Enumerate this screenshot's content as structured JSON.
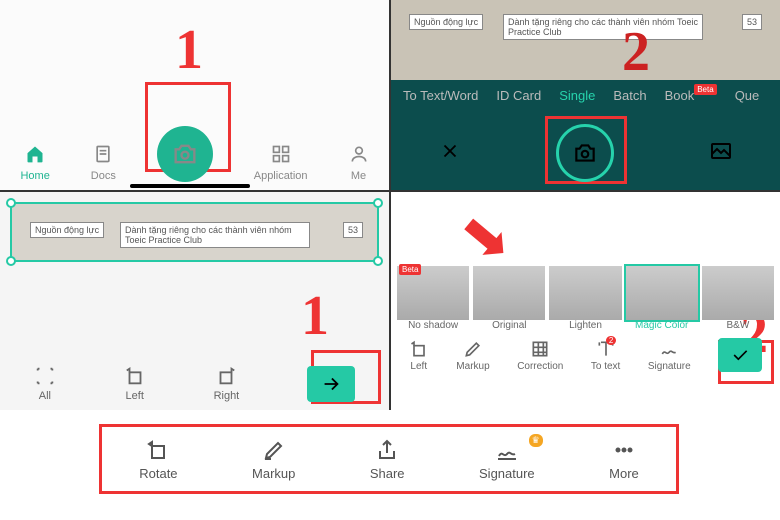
{
  "panel1": {
    "nav": {
      "home": "Home",
      "docs": "Docs",
      "app": "Application",
      "me": "Me"
    },
    "num": "1"
  },
  "panel2": {
    "tabs": {
      "text": "To Text/Word",
      "id": "ID Card",
      "single": "Single",
      "batch": "Batch",
      "book": "Book",
      "que": "Que"
    },
    "beta": "Beta",
    "num": "2",
    "doc_label": "Nguồn động lực",
    "doc_text": "Dành tặng riêng cho các thành viên nhóm Toeic Practice Club",
    "page": "53"
  },
  "panel3": {
    "nav": {
      "all": "All",
      "left": "Left",
      "right": "Right"
    },
    "num": "1",
    "doc_label": "Nguồn động lực",
    "doc_text": "Dành tặng riêng cho các thành viên nhóm Toeic Practice Club",
    "page": "53"
  },
  "panel4": {
    "filters": {
      "noshadow": "No shadow",
      "original": "Original",
      "lighten": "Lighten",
      "magic": "Magic Color",
      "bw": "B&W"
    },
    "beta": "Beta",
    "nav": {
      "left": "Left",
      "markup": "Markup",
      "correction": "Correction",
      "totext": "To text",
      "signature": "Signature"
    },
    "notif": "2",
    "num": "2"
  },
  "toolbar": {
    "rotate": "Rotate",
    "markup": "Markup",
    "share": "Share",
    "signature": "Signature",
    "more": "More"
  }
}
